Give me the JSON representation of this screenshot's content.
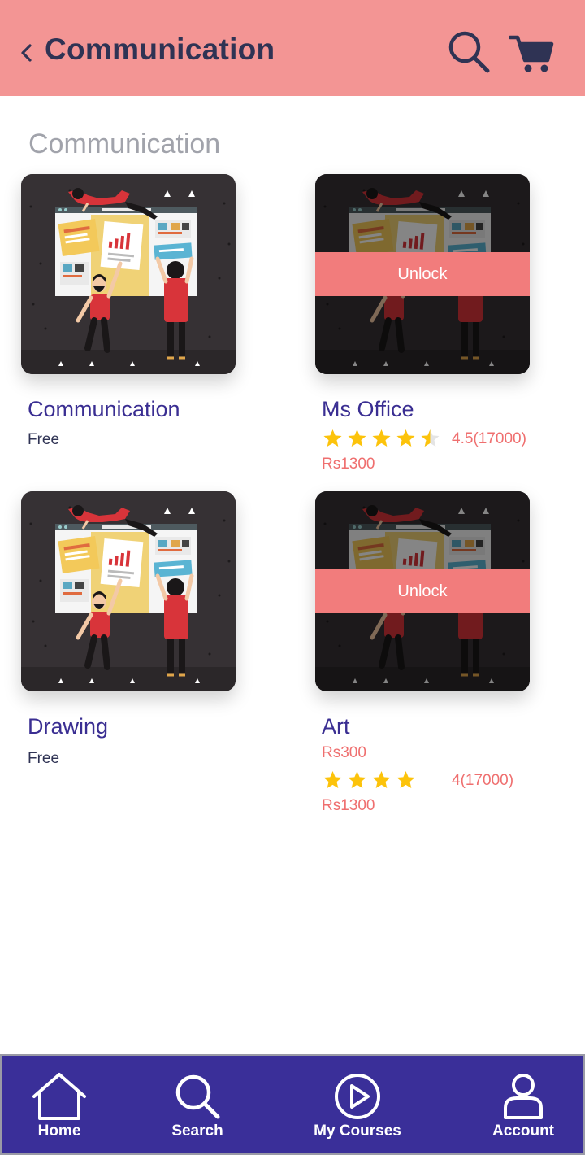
{
  "header": {
    "title": "Communication"
  },
  "section": {
    "title": "Communication"
  },
  "courses": [
    {
      "title": "Communication",
      "price_label": "Free",
      "locked": false
    },
    {
      "title": "Ms Office",
      "rating": 4.5,
      "rating_text": "4.5(17000)",
      "price": "Rs1300",
      "locked": true,
      "unlock_label": "Unlock"
    },
    {
      "title": "Drawing",
      "price_label": "Free",
      "locked": false
    },
    {
      "title": "Art",
      "original_price": "Rs300",
      "rating": 4,
      "rating_text": "4(17000)",
      "price": "Rs1300",
      "locked": true,
      "unlock_label": "Unlock"
    }
  ],
  "nav": [
    {
      "label": "Home",
      "icon": "home-icon"
    },
    {
      "label": "Search",
      "icon": "search-icon"
    },
    {
      "label": "My Courses",
      "icon": "play-icon"
    },
    {
      "label": "Account",
      "icon": "user-icon"
    }
  ],
  "colors": {
    "header_bg": "#f39594",
    "nav_bg": "#3a2f99",
    "accent": "#f27c7c",
    "title": "#3a2e92",
    "star": "#fcc30b"
  }
}
